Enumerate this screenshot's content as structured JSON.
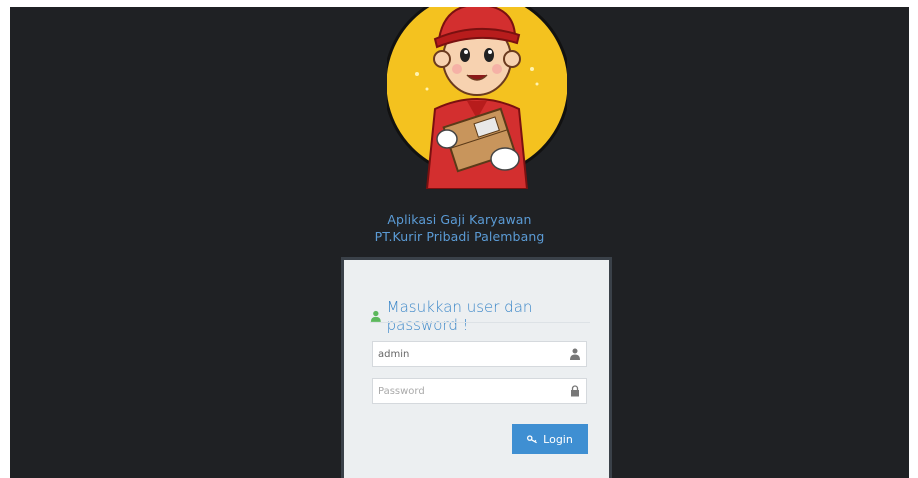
{
  "app": {
    "title_line1": "Aplikasi Gaji Karyawan",
    "title_line2": "PT.Kurir Pribadi Palembang"
  },
  "login": {
    "header": "Masukkan user dan password !",
    "username_value": "admin",
    "password_placeholder": "Password",
    "button_label": "Login"
  },
  "colors": {
    "background": "#1f2124",
    "title_text": "#5b9bd5",
    "header_text": "#3a86c8",
    "user_icon": "#5cb85c",
    "button": "#3f8fd2"
  },
  "icons": {
    "header": "user-icon",
    "username": "user-icon",
    "password": "lock-icon",
    "button": "key-icon"
  }
}
